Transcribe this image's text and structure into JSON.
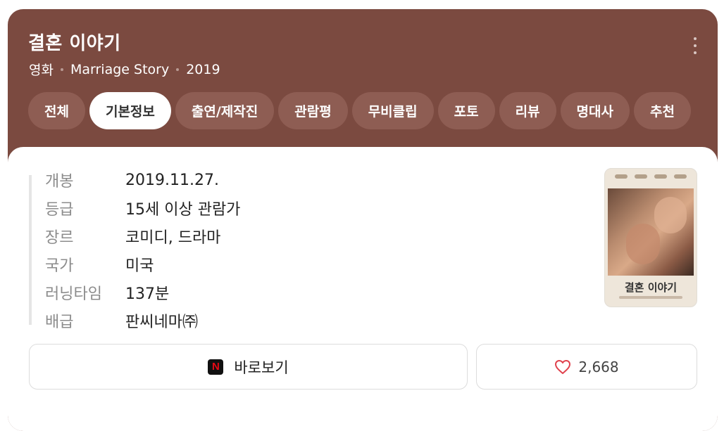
{
  "header": {
    "title": "결혼 이야기",
    "subtitle": [
      "영화",
      "Marriage Story",
      "2019"
    ]
  },
  "tabs": [
    {
      "label": "전체",
      "active": false
    },
    {
      "label": "기본정보",
      "active": true
    },
    {
      "label": "출연/제작진",
      "active": false
    },
    {
      "label": "관람평",
      "active": false
    },
    {
      "label": "무비클립",
      "active": false
    },
    {
      "label": "포토",
      "active": false
    },
    {
      "label": "리뷰",
      "active": false
    },
    {
      "label": "명대사",
      "active": false
    },
    {
      "label": "추천",
      "active": false
    }
  ],
  "info": [
    {
      "key": "개봉",
      "value": "2019.11.27."
    },
    {
      "key": "등급",
      "value": "15세 이상 관람가"
    },
    {
      "key": "장르",
      "value": "코미디, 드라마"
    },
    {
      "key": "국가",
      "value": "미국"
    },
    {
      "key": "러닝타임",
      "value": "137분"
    },
    {
      "key": "배급",
      "value": "판씨네마㈜"
    }
  ],
  "poster": {
    "title": "결혼 이야기"
  },
  "actions": {
    "watch_label": "바로보기",
    "watch_icon": "N",
    "like_count": "2,668"
  },
  "colors": {
    "header_bg": "#7b4a40",
    "tab_bg": "#8e5d53",
    "netflix_red": "#e50914",
    "heart": "#e0424d"
  }
}
